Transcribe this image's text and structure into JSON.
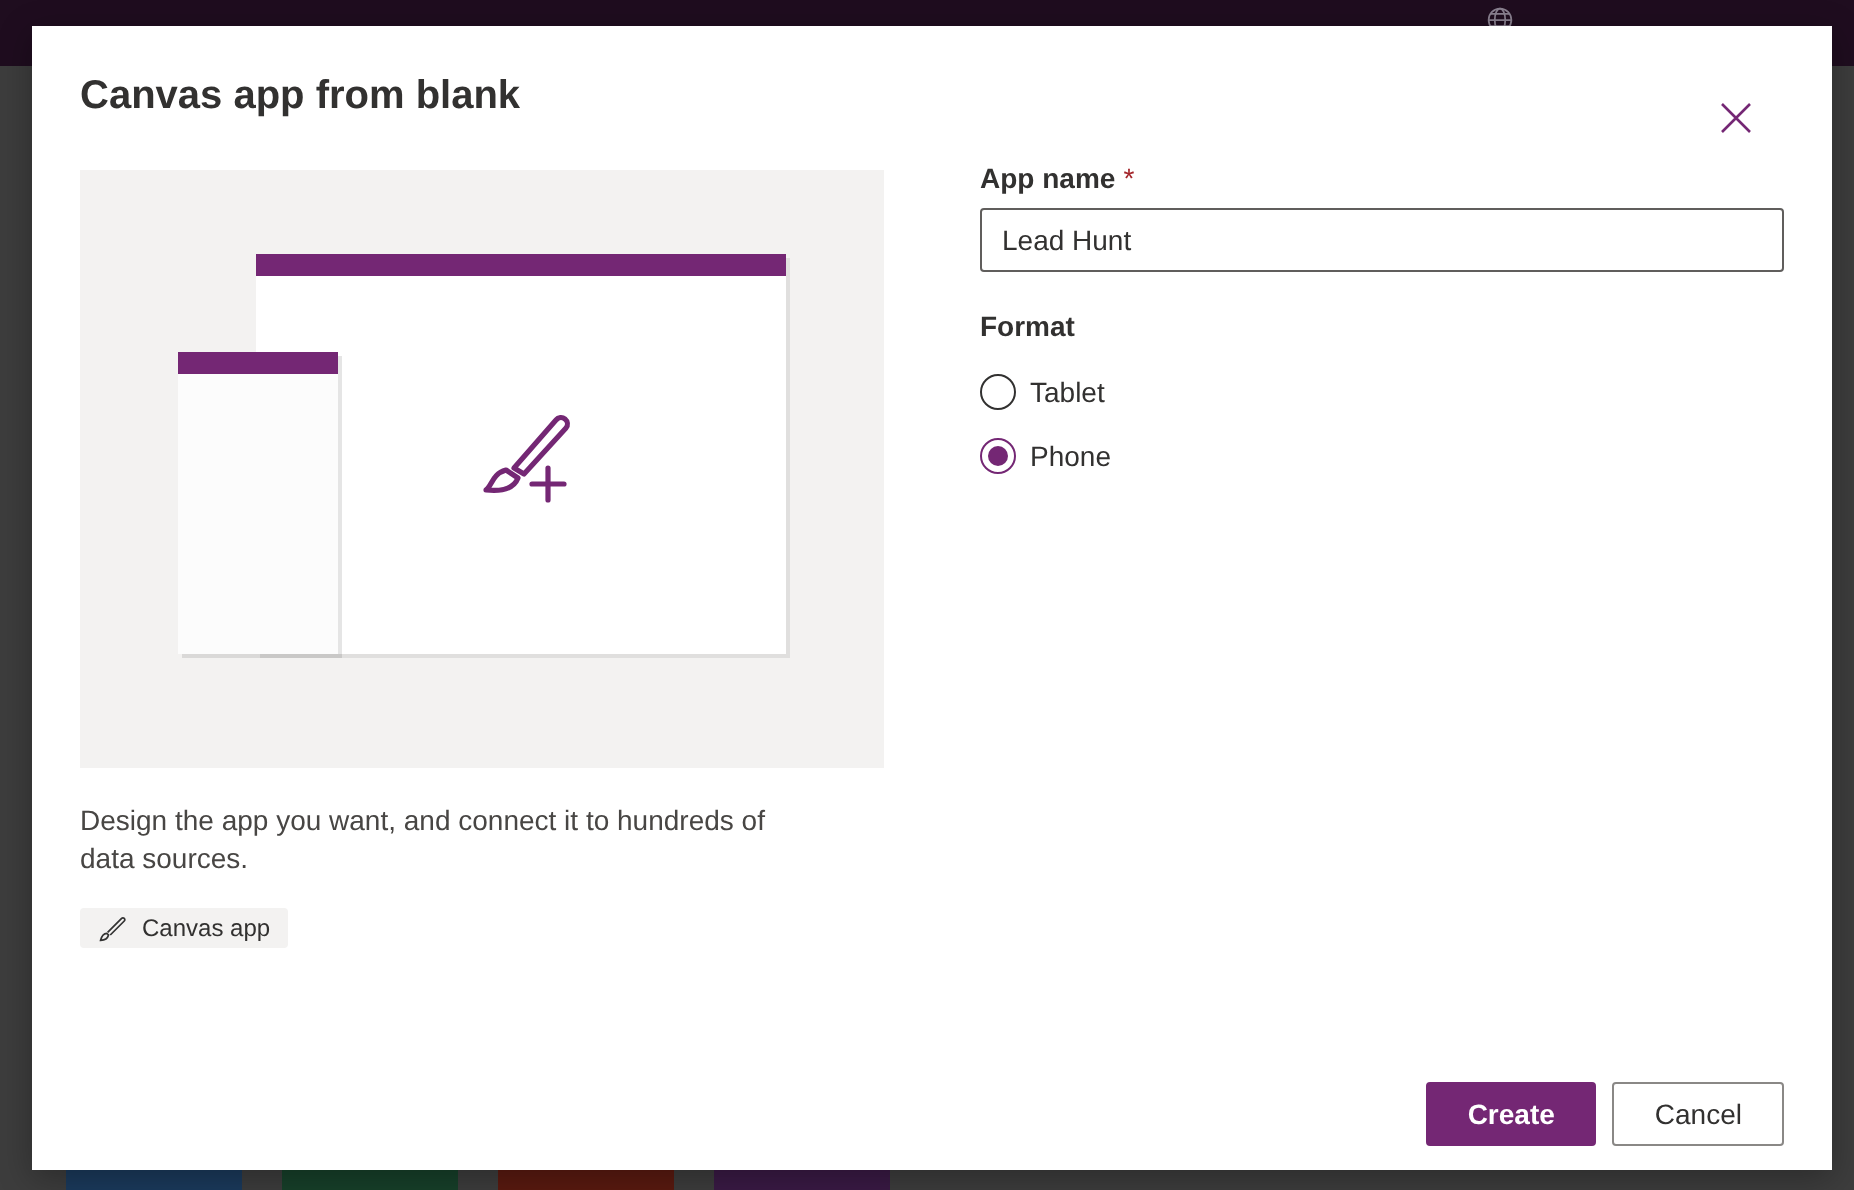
{
  "dialog": {
    "title": "Canvas app from blank",
    "description": "Design the app you want, and connect it to hundreds of data sources.",
    "tag": {
      "label": "Canvas app"
    },
    "app_name": {
      "label": "App name",
      "required_mark": "*",
      "value": "Lead Hunt"
    },
    "format": {
      "label": "Format",
      "options": [
        {
          "label": "Tablet",
          "selected": false
        },
        {
          "label": "Phone",
          "selected": true
        }
      ]
    },
    "buttons": [
      {
        "label": "Create",
        "kind": "primary"
      },
      {
        "label": "Cancel",
        "kind": "secondary"
      }
    ]
  }
}
